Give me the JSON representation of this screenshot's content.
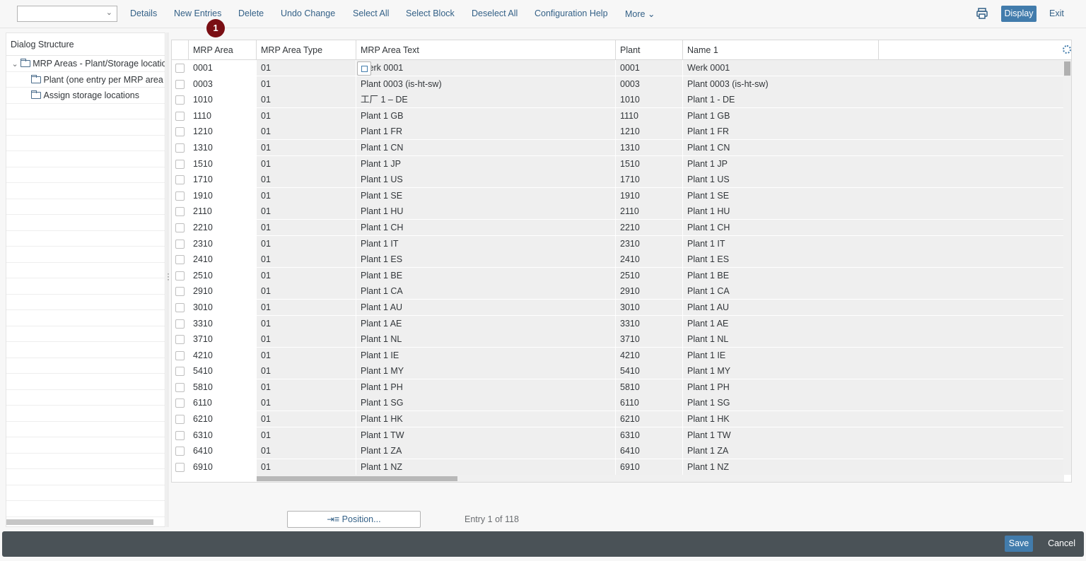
{
  "toolbar": {
    "dropdown_value": "",
    "buttons": [
      "Details",
      "New Entries",
      "Delete",
      "Undo Change",
      "Select All",
      "Select Block",
      "Deselect All",
      "Configuration Help",
      "More"
    ],
    "badge": "1",
    "display": "Display",
    "exit": "Exit"
  },
  "dialog": {
    "title": "Dialog Structure",
    "items": [
      {
        "label": "MRP Areas - Plant/Storage locatio",
        "expanded": true,
        "level": 0
      },
      {
        "label": "Plant (one entry per MRP area",
        "level": 1
      },
      {
        "label": "Assign storage locations",
        "level": 1
      }
    ]
  },
  "table": {
    "columns": [
      "MRP Area",
      "MRP Area Type",
      "MRP Area Text",
      "Plant",
      "Name 1"
    ],
    "rows": [
      [
        "0001",
        "01",
        "Werk 0001",
        "0001",
        "Werk 0001"
      ],
      [
        "0003",
        "01",
        "Plant 0003 (is-ht-sw)",
        "0003",
        "Plant 0003 (is-ht-sw)"
      ],
      [
        "1010",
        "01",
        "工厂 1 – DE",
        "1010",
        "Plant 1 - DE"
      ],
      [
        "1110",
        "01",
        "Plant 1 GB",
        "1110",
        "Plant 1 GB"
      ],
      [
        "1210",
        "01",
        "Plant 1 FR",
        "1210",
        "Plant 1 FR"
      ],
      [
        "1310",
        "01",
        "Plant 1 CN",
        "1310",
        "Plant 1 CN"
      ],
      [
        "1510",
        "01",
        "Plant 1 JP",
        "1510",
        "Plant 1 JP"
      ],
      [
        "1710",
        "01",
        "Plant 1 US",
        "1710",
        "Plant 1 US"
      ],
      [
        "1910",
        "01",
        "Plant 1 SE",
        "1910",
        "Plant 1 SE"
      ],
      [
        "2110",
        "01",
        "Plant 1 HU",
        "2110",
        "Plant 1 HU"
      ],
      [
        "2210",
        "01",
        "Plant 1 CH",
        "2210",
        "Plant 1 CH"
      ],
      [
        "2310",
        "01",
        "Plant 1 IT",
        "2310",
        "Plant 1 IT"
      ],
      [
        "2410",
        "01",
        "Plant 1 ES",
        "2410",
        "Plant 1 ES"
      ],
      [
        "2510",
        "01",
        "Plant 1 BE",
        "2510",
        "Plant 1 BE"
      ],
      [
        "2910",
        "01",
        "Plant 1 CA",
        "2910",
        "Plant 1 CA"
      ],
      [
        "3010",
        "01",
        "Plant 1 AU",
        "3010",
        "Plant 1 AU"
      ],
      [
        "3310",
        "01",
        "Plant 1 AE",
        "3310",
        "Plant 1 AE"
      ],
      [
        "3710",
        "01",
        "Plant 1 NL",
        "3710",
        "Plant 1 NL"
      ],
      [
        "4210",
        "01",
        "Plant 1 IE",
        "4210",
        "Plant 1 IE"
      ],
      [
        "5410",
        "01",
        "Plant 1 MY",
        "5410",
        "Plant 1 MY"
      ],
      [
        "5810",
        "01",
        "Plant 1 PH",
        "5810",
        "Plant 1 PH"
      ],
      [
        "6110",
        "01",
        "Plant 1 SG",
        "6110",
        "Plant 1 SG"
      ],
      [
        "6210",
        "01",
        "Plant 1 HK",
        "6210",
        "Plant 1 HK"
      ],
      [
        "6310",
        "01",
        "Plant 1 TW",
        "6310",
        "Plant 1 TW"
      ],
      [
        "6410",
        "01",
        "Plant 1 ZA",
        "6410",
        "Plant 1 ZA"
      ],
      [
        "6910",
        "01",
        "Plant 1 NZ",
        "6910",
        "Plant 1 NZ"
      ]
    ]
  },
  "bottom": {
    "position_button": "⇥≡ Position...",
    "entry_info": "Entry 1 of 118"
  },
  "footer": {
    "save": "Save",
    "cancel": "Cancel"
  },
  "colors": {
    "accent": "#427cac",
    "link": "#346187",
    "badge": "#7a0f14",
    "footer": "#4a5257"
  }
}
